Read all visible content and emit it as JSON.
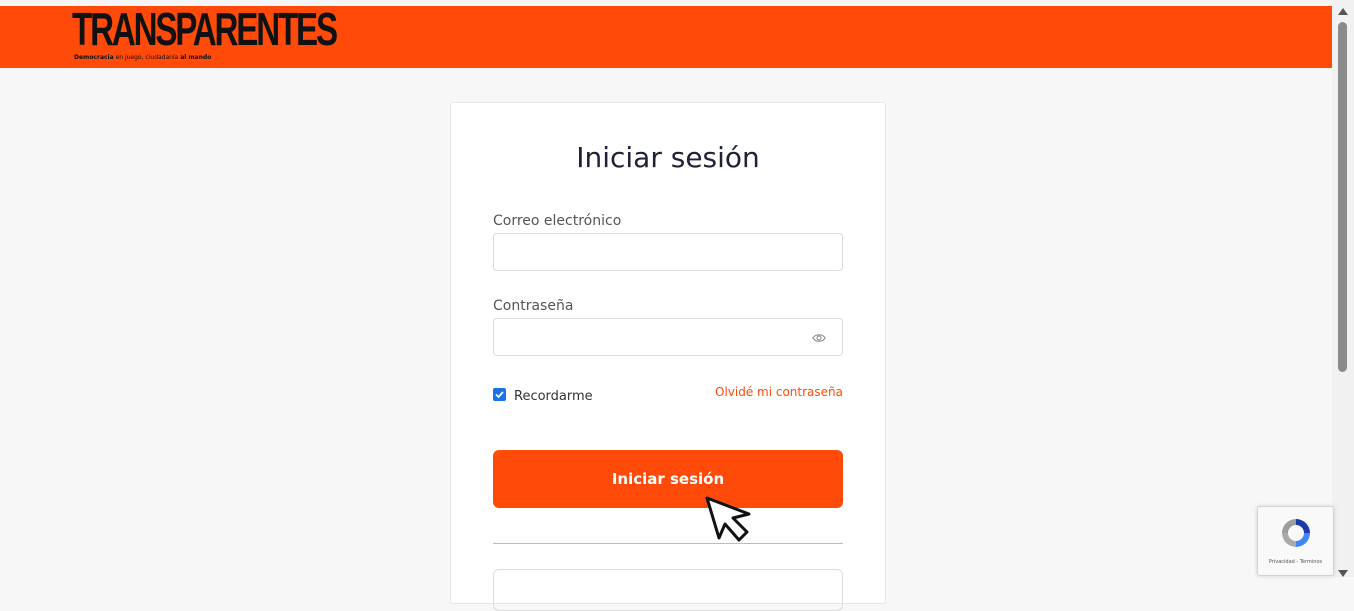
{
  "header": {
    "logo_title": "TRANSPARENTES",
    "tagline_bold1": "Democracia",
    "tagline_mid": " en juego, ciudadanía ",
    "tagline_bold2": "al mando"
  },
  "login": {
    "title": "Iniciar sesión",
    "email_label": "Correo electrónico",
    "email_value": "",
    "password_label": "Contraseña",
    "password_value": "",
    "remember_label": "Recordarme",
    "remember_checked": true,
    "forgot_link": "Olvidé mi contraseña",
    "submit_label": "Iniciar sesión"
  },
  "recaptcha": {
    "footer_text": "Privacidad - Términos"
  },
  "colors": {
    "brand": "#ff4a0a",
    "title_text": "#1f2236",
    "checkbox": "#1a73e8"
  },
  "icons": {
    "password_toggle": "eye-icon",
    "remember": "checkbox-checked-icon",
    "pointer": "mouse-cursor-icon",
    "captcha": "recaptcha-icon"
  }
}
